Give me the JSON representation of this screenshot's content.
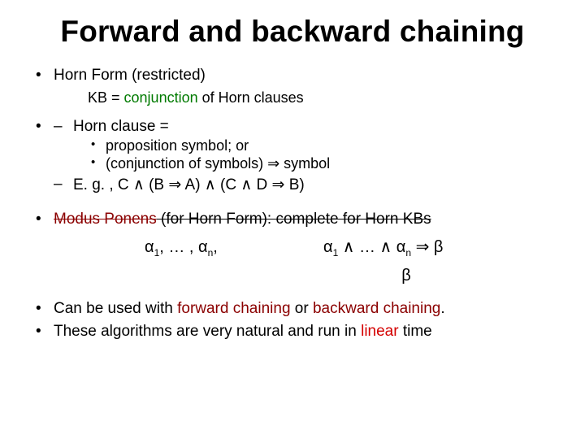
{
  "title": "Forward and backward chaining",
  "b1": {
    "main": "Horn Form (restricted)",
    "kb_prefix": "KB = ",
    "kb_highlight": "conjunction",
    "kb_rest": " of Horn clauses",
    "hc_label": "Horn clause =",
    "hc_opt1": "proposition symbol;  or",
    "hc_opt2": "(conjunction of symbols) ⇒ symbol",
    "eg": "E. g. , C ∧ (B ⇒ A) ∧ (C ∧ D ⇒ B)"
  },
  "b2": {
    "mp": "Modus Ponens",
    "mp_rest": " (for Horn Form): complete for Horn KBs",
    "left_a1": "α",
    "left_s1": "1",
    "left_mid": ", … , ",
    "left_an": "α",
    "left_sn": "n",
    "left_tail": ",",
    "right_a1": "α",
    "right_s1": "1",
    "right_mid": " ∧ … ∧ ",
    "right_an": "α",
    "right_sn": "n",
    "right_tail": " ⇒ β",
    "beta": "β"
  },
  "b3": {
    "pre": "Can be used with ",
    "fc": "forward chaining",
    "or": " or ",
    "bc": "backward chaining",
    "dot": "."
  },
  "b4": {
    "pre": "These algorithms are very natural and run in ",
    "lin": "linear",
    "post": " time"
  }
}
